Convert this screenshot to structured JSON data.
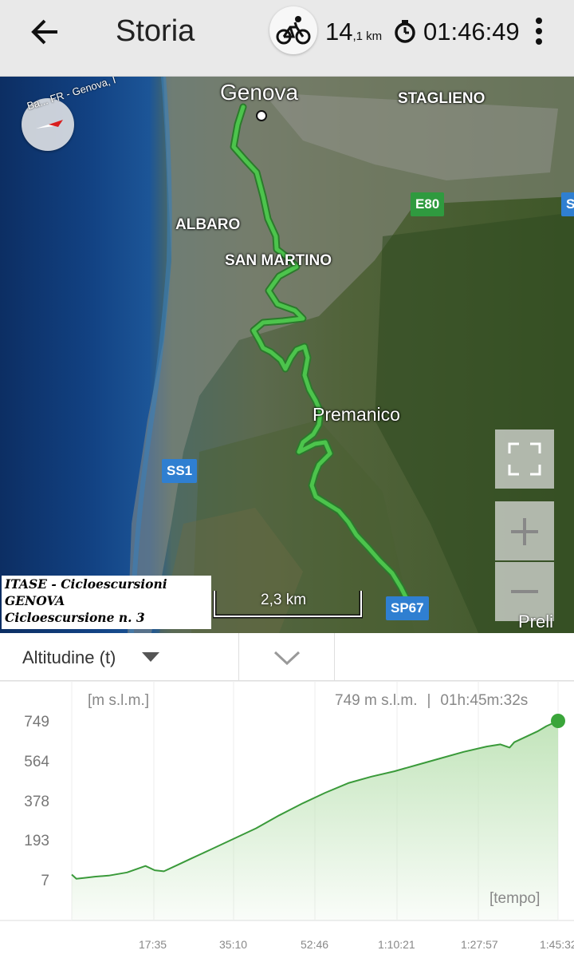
{
  "header": {
    "title": "Storia",
    "distance_value": "14",
    "distance_unit": ",1 km",
    "elapsed_time": "01:46:49",
    "activity_icon": "bicycle-icon",
    "timer_icon": "stopwatch-icon"
  },
  "map": {
    "compass_label": "Ba... FR - Genova, I`",
    "places": {
      "genova": "Genova",
      "staglieno": "STAGLIENO",
      "albaro": "ALBARO",
      "san_martino": "SAN MARTINO",
      "premanico": "Premanico"
    },
    "roads": {
      "e80": "E80",
      "ss1": "SS1",
      "sp67": "SP67",
      "edge": "S"
    },
    "scale_label": "2,3 km",
    "provider_label": "Preli",
    "watermark": {
      "line1": "ITASE - Cicloescursioni",
      "line2": "GENOVA",
      "line3": "Cicloescursione n. 3"
    },
    "route_color": "#3cad3c"
  },
  "selector": {
    "metric": "Altitudine (t)"
  },
  "chart_data": {
    "type": "area",
    "ylabel": "[m s.l.m.]",
    "xlabel": "[tempo]",
    "readout_value": "749 m s.l.m.",
    "readout_sep": "|",
    "readout_time": "01h:45m:32s",
    "yticks": [
      "749",
      "564",
      "378",
      "193",
      "7"
    ],
    "xticks": [
      "17:35",
      "35:10",
      "52:46",
      "1:10:21",
      "1:27:57",
      "1:45:32"
    ],
    "ylim": [
      7,
      749
    ],
    "x_minutes": [
      0,
      1,
      3,
      5,
      8,
      12,
      16,
      18,
      20,
      23,
      26,
      30,
      35,
      40,
      45,
      50,
      55,
      60,
      65,
      70,
      75,
      80,
      85,
      90,
      93,
      95,
      96,
      98,
      101,
      103,
      105.5
    ],
    "values": [
      35,
      15,
      20,
      25,
      30,
      45,
      75,
      55,
      50,
      80,
      110,
      150,
      200,
      250,
      310,
      365,
      415,
      460,
      490,
      515,
      545,
      575,
      605,
      630,
      640,
      625,
      650,
      670,
      700,
      725,
      749
    ],
    "line_color": "#3a9a3a",
    "fill_color": "#bfe3b7",
    "marker_color": "#3aa53a",
    "grid": true
  }
}
